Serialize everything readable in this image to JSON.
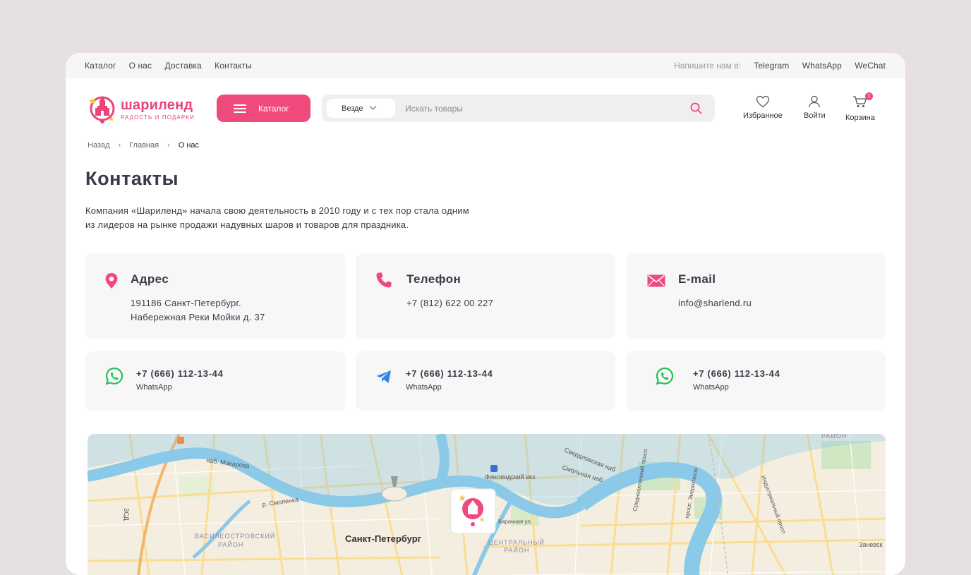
{
  "topbar": {
    "nav": [
      "Каталог",
      "О нас",
      "Доставка",
      "Контакты"
    ],
    "write_label": "Напишите нам в:",
    "messengers": [
      "Telegram",
      "WhatsApp",
      "WeChat"
    ]
  },
  "header": {
    "logo_name": "шариленд",
    "logo_tagline": "РАДОСТЬ И ПОДАРКИ",
    "catalog_label": "Каталог",
    "search_scope": "Везде",
    "search_placeholder": "Искать товары",
    "favorites_label": "Избранное",
    "login_label": "Войти",
    "cart_label": "Корзина",
    "cart_count": "1",
    "brand_color": "#ee4a7c"
  },
  "breadcrumbs": {
    "back": "Назад",
    "home": "Главная",
    "current": "О нас"
  },
  "page": {
    "title": "Контакты",
    "intro_line1": "Компания «Шариленд» начала свою деятельность в 2010 году и с тех пор стала одним",
    "intro_line2": "из лидеров на рынке продажи надувных шаров и товаров для праздника."
  },
  "contacts": {
    "address": {
      "title": "Адрес",
      "line1": "191186 Санкт-Петербург.",
      "line2": "Набережная Реки Мойки д. 37",
      "icon": "map-pin-icon"
    },
    "phone": {
      "title": "Телефон",
      "value": "+7 (812) 622 00 227",
      "icon": "phone-icon"
    },
    "email": {
      "title": "E-mail",
      "value": "info@sharlend.ru",
      "icon": "envelope-icon"
    }
  },
  "messengers": [
    {
      "phone": "+7 (666) 112-13-44",
      "name": "WhatsApp",
      "icon": "whatsapp-icon",
      "color": "#25c05a"
    },
    {
      "phone": "+7 (666) 112-13-44",
      "name": "WhatsApp",
      "icon": "telegram-icon",
      "color": "#2f86e6"
    },
    {
      "phone": "+7 (666) 112-13-44",
      "name": "WhatsApp",
      "icon": "whatsapp-icon",
      "color": "#25c05a"
    }
  ],
  "map": {
    "labels": {
      "city": "Санкт-Петербург",
      "vasileostrovsky": "ВАСИЛЕОСТРОВСКИЙ",
      "district": "РАЙОН",
      "central": "ЦЕНТРАЛЬНЫЙ",
      "central_district": "РАЙОН",
      "finland_station": "Финляндский вкз.",
      "sverdlovskaya": "Свердловская наб",
      "smolnaya": "Смольная наб",
      "makarova": "наб. Макарова",
      "smolenka": "р. Смоленка",
      "kirochnaya": "Кирочная ул.",
      "energetikov": "просп. Энергетиков",
      "industrialny": "Индустриальный просп",
      "sredneokhtinsky": "Среднеохтинский просп",
      "zanevsky": "Заневск",
      "zsd": "ЗСД",
      "raion_top": "РАЙОН"
    }
  }
}
